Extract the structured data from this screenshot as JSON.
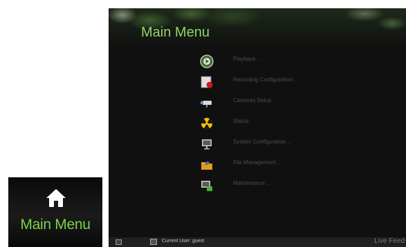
{
  "home_widget": {
    "label": "Main Menu",
    "icon": "home-icon"
  },
  "window": {
    "title": "Main Menu",
    "menu": [
      {
        "label": "Playback ..",
        "icon": "playback-icon"
      },
      {
        "label": "Recording Configuration ..",
        "icon": "recording-icon"
      },
      {
        "label": "Cameras Setup ..",
        "icon": "camera-icon"
      },
      {
        "label": "Status",
        "icon": "status-radiation-icon"
      },
      {
        "label": "System Configuration ..",
        "icon": "monitor-icon"
      },
      {
        "label": "File Management ..",
        "icon": "folder-icon"
      },
      {
        "label": "Maintenance ..",
        "icon": "maintenance-icon"
      }
    ]
  },
  "statusbar": {
    "user": "Current User: guest",
    "live": "Live Feed"
  },
  "colors": {
    "accent_green": "#8fd46a",
    "background": "#101010",
    "menu_text": "#4d4d4d"
  }
}
